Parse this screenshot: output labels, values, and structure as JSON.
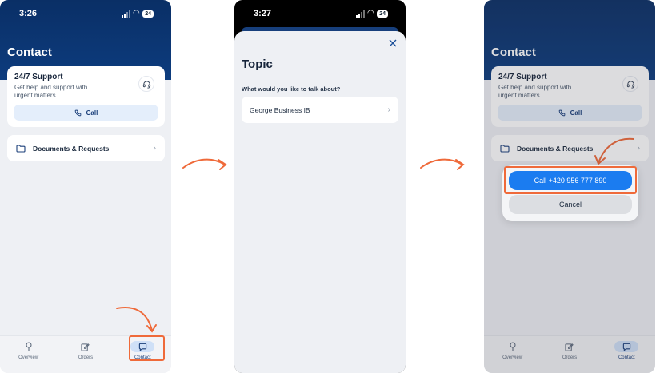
{
  "screen1": {
    "time": "3:26",
    "battery": "24",
    "title": "Contact",
    "support": {
      "title": "24/7 Support",
      "description": "Get help and support with urgent matters.",
      "call_label": "Call"
    },
    "documents_label": "Documents & Requests",
    "tabs": [
      {
        "label": "Overview"
      },
      {
        "label": "Orders"
      },
      {
        "label": "Contact"
      }
    ]
  },
  "screen2": {
    "time": "3:27",
    "battery": "24",
    "title": "Topic",
    "question": "What would you like to talk about?",
    "topic_item": "George Business IB"
  },
  "screen3": {
    "title": "Contact",
    "support": {
      "title": "24/7 Support",
      "description": "Get help and support with urgent matters.",
      "call_label": "Call"
    },
    "documents_label": "Documents & Requests",
    "call_number_label": "Call +420 956 777 890",
    "cancel_label": "Cancel",
    "tabs": [
      {
        "label": "Overview"
      },
      {
        "label": "Orders"
      },
      {
        "label": "Contact"
      }
    ]
  },
  "colors": {
    "header": "#0d3c7e",
    "accent": "#1b7cf0",
    "annotation": "#ef6a3a"
  }
}
